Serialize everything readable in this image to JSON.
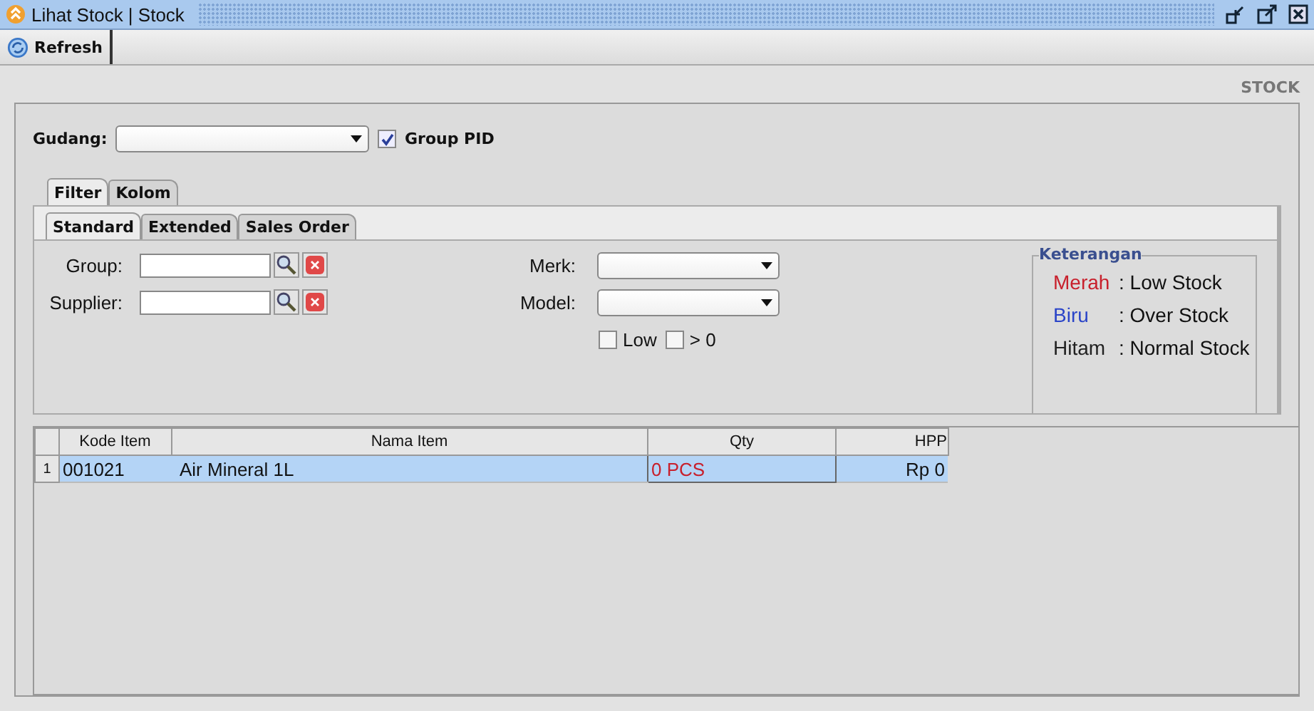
{
  "window": {
    "title": "Lihat Stock | Stock"
  },
  "toolbar": {
    "refresh_label": "Refresh"
  },
  "page_heading": "STOCK",
  "gudang": {
    "label": "Gudang:"
  },
  "group_pid": {
    "label": "Group PID",
    "checked": true
  },
  "outer_tabs": [
    {
      "label": "Filter",
      "selected": true
    },
    {
      "label": "Kolom",
      "selected": false
    }
  ],
  "inner_tabs": [
    {
      "label": "Standard",
      "selected": true
    },
    {
      "label": "Extended",
      "selected": false
    },
    {
      "label": "Sales Order",
      "selected": false
    }
  ],
  "lookup_fields": [
    {
      "label": "Group:"
    },
    {
      "label": "Supplier:"
    }
  ],
  "dropdowns": [
    {
      "label": "Merk:"
    },
    {
      "label": "Model:"
    }
  ],
  "checkboxes": [
    {
      "label": "Low",
      "checked": false
    },
    {
      "label": "> 0",
      "checked": false
    }
  ],
  "legend": {
    "title": "Keterangan",
    "items": [
      {
        "name": "Merah",
        "desc": ": Low Stock",
        "color": "#c8202c"
      },
      {
        "name": "Biru",
        "desc": ": Over Stock",
        "color": "#2a44c8"
      },
      {
        "name": "Hitam",
        "desc": ": Normal Stock",
        "color": "#222222"
      }
    ]
  },
  "table": {
    "columns": [
      "Kode Item",
      "Nama Item",
      "Qty",
      "HPP"
    ],
    "rows": [
      {
        "number": "1",
        "cells": [
          "001021",
          "Air Mineral 1L",
          "0 PCS",
          "Rp 0"
        ],
        "selected": true,
        "color": "#c8202c"
      }
    ]
  }
}
